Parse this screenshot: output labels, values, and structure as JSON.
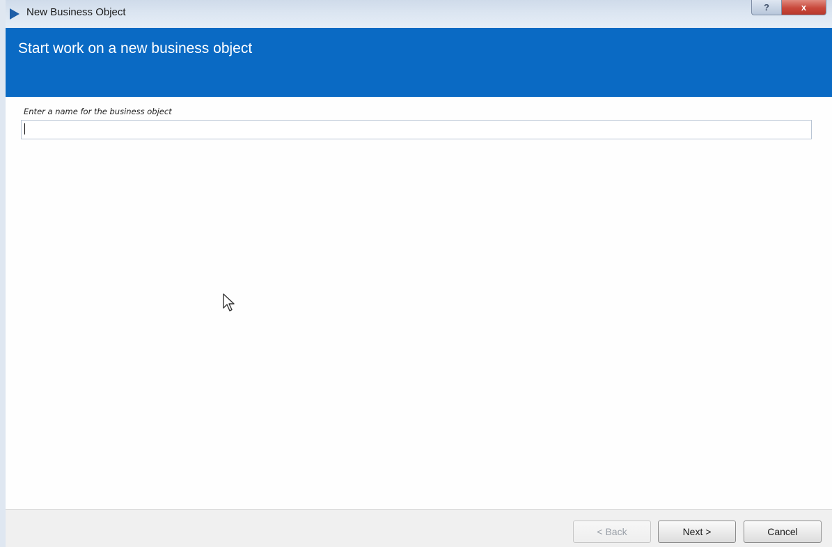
{
  "window": {
    "title": "New Business Object",
    "help_label": "?",
    "close_label": "x"
  },
  "header": {
    "title": "Start work on a new business object"
  },
  "form": {
    "name_label": "Enter a name for the business object",
    "name_value": "",
    "name_placeholder": ""
  },
  "footer": {
    "back_label": "< Back",
    "next_label": "Next >",
    "cancel_label": "Cancel"
  },
  "colors": {
    "header_blue": "#0a6ac4",
    "close_red": "#c9483b"
  },
  "icons": [
    "app-icon",
    "help-icon",
    "close-icon",
    "mouse-cursor-icon"
  ]
}
